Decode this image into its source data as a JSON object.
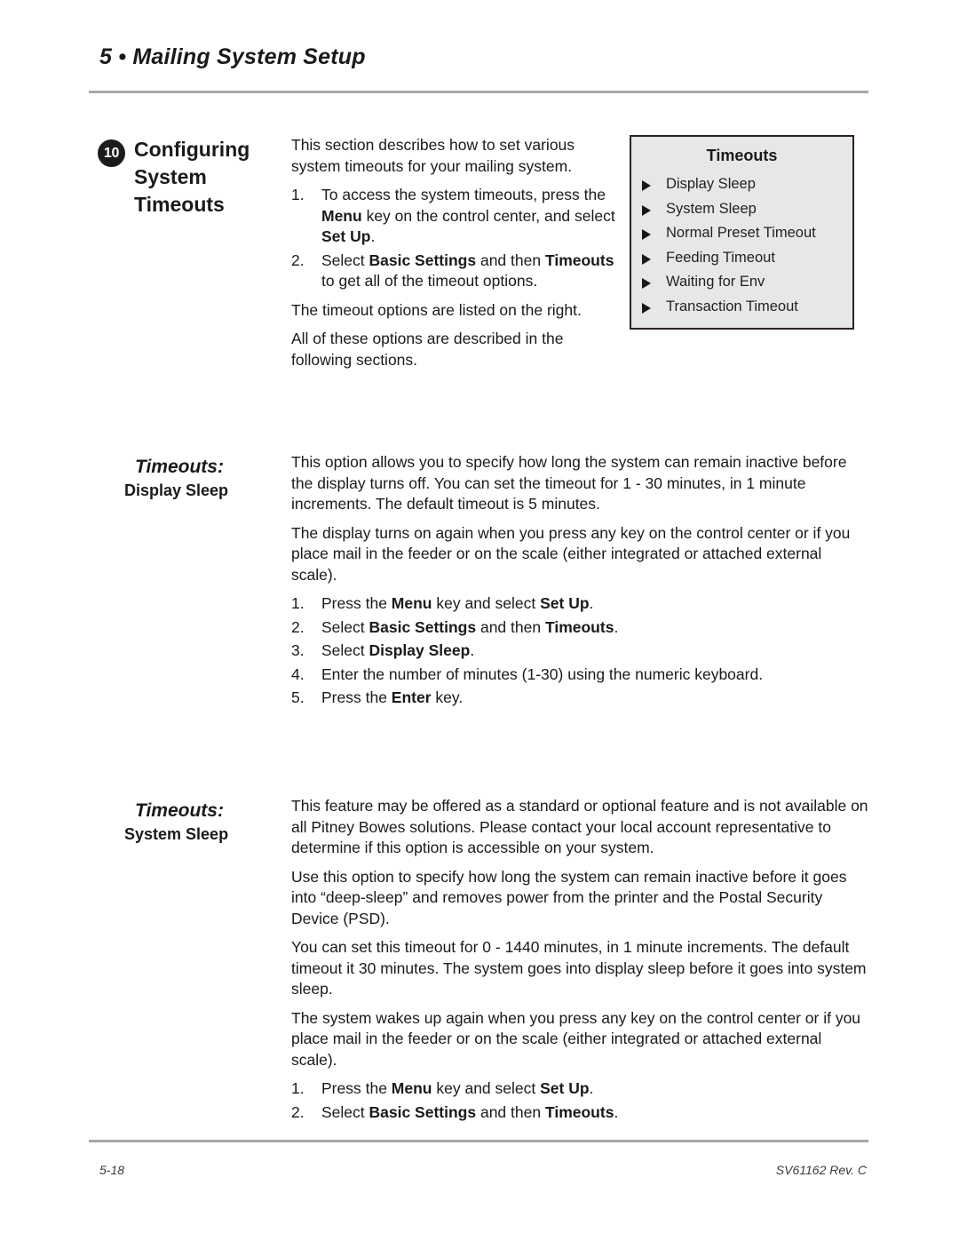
{
  "header": {
    "chapter": "5 • Mailing System Setup"
  },
  "footer": {
    "page_number": "5-18",
    "doc_ref": "SV61162 Rev. C"
  },
  "section": {
    "badge": "10",
    "title": "Configuring System Timeouts"
  },
  "intro": {
    "paragraph_1": "This section describes how to set various system timeouts for your mailing system.",
    "steps": [
      {
        "num": "1.",
        "segments": [
          {
            "text": "To access the system timeouts, press the ",
            "bold": false
          },
          {
            "text": "Menu",
            "bold": true
          },
          {
            "text": " key on the control center, and select ",
            "bold": false
          },
          {
            "text": "Set Up",
            "bold": true
          },
          {
            "text": ".",
            "bold": false
          }
        ]
      },
      {
        "num": "2.",
        "segments": [
          {
            "text": "Select ",
            "bold": false
          },
          {
            "text": "Basic Settings",
            "bold": true
          },
          {
            "text": " and then ",
            "bold": false
          },
          {
            "text": "Timeouts",
            "bold": true
          },
          {
            "text": " to get all of the timeout options.",
            "bold": false
          }
        ]
      }
    ],
    "paragraph_2": "The timeout options are listed on the right.",
    "paragraph_3": "All of these options are described in the following sections."
  },
  "callout": {
    "title": "Timeouts",
    "bullet_icon": "triangle-right-icon",
    "items": [
      "Display Sleep",
      "System Sleep",
      "Normal Preset Timeout",
      "Feeding Timeout",
      "Waiting for Env",
      "Transaction Timeout"
    ]
  },
  "display_sleep": {
    "sidehead_label": "Timeouts:",
    "sidehead_sub": "Display Sleep",
    "paragraph_1": "This option allows you to specify how long the system can remain inactive before the display turns off. You can set the timeout for 1 - 30 minutes, in 1 minute increments. The default timeout is 5 minutes.",
    "paragraph_2": "The display turns on again when you press any key on the control center or if you place mail in the feeder or on the scale (either integrated or attached external scale).",
    "steps": [
      {
        "num": "1.",
        "segments": [
          {
            "text": "Press the ",
            "bold": false
          },
          {
            "text": "Menu",
            "bold": true
          },
          {
            "text": " key and select ",
            "bold": false
          },
          {
            "text": "Set Up",
            "bold": true
          },
          {
            "text": ".",
            "bold": false
          }
        ]
      },
      {
        "num": "2.",
        "segments": [
          {
            "text": "Select ",
            "bold": false
          },
          {
            "text": "Basic Settings",
            "bold": true
          },
          {
            "text": " and then ",
            "bold": false
          },
          {
            "text": "Timeouts",
            "bold": true
          },
          {
            "text": ".",
            "bold": false
          }
        ]
      },
      {
        "num": "3.",
        "segments": [
          {
            "text": "Select ",
            "bold": false
          },
          {
            "text": "Display Sleep",
            "bold": true
          },
          {
            "text": ".",
            "bold": false
          }
        ]
      },
      {
        "num": "4.",
        "segments": [
          {
            "text": "Enter the number of minutes (1-30) using the numeric keyboard.",
            "bold": false
          }
        ]
      },
      {
        "num": "5.",
        "segments": [
          {
            "text": "Press the ",
            "bold": false
          },
          {
            "text": "Enter",
            "bold": true
          },
          {
            "text": " key.",
            "bold": false
          }
        ]
      }
    ]
  },
  "system_sleep": {
    "sidehead_label": "Timeouts:",
    "sidehead_sub": "System Sleep",
    "paragraph_1": "This feature may be offered as a standard or optional feature and is not available on all Pitney Bowes solutions. Please contact your local account representative to determine if this option is accessible on your system.",
    "paragraph_2": "Use this option to specify how long the system can remain inactive before it goes into “deep-sleep” and removes power from the printer and the Postal Security Device (PSD).",
    "paragraph_3": "You can set this timeout for 0 - 1440 minutes, in 1 minute increments.  The default timeout it 30 minutes. The system goes into display sleep before it goes into system sleep.",
    "paragraph_4": "The system wakes up again when you press any key on the control center or if you place mail in the feeder or on the scale (either integrated or attached external scale).",
    "steps": [
      {
        "num": "1.",
        "segments": [
          {
            "text": "Press the ",
            "bold": false
          },
          {
            "text": "Menu",
            "bold": true
          },
          {
            "text": " key and select ",
            "bold": false
          },
          {
            "text": "Set Up",
            "bold": true
          },
          {
            "text": ".",
            "bold": false
          }
        ]
      },
      {
        "num": "2.",
        "segments": [
          {
            "text": "Select ",
            "bold": false
          },
          {
            "text": "Basic Settings",
            "bold": true
          },
          {
            "text": " and then ",
            "bold": false
          },
          {
            "text": "Timeouts",
            "bold": true
          },
          {
            "text": ".",
            "bold": false
          }
        ]
      }
    ]
  },
  "colors": {
    "text": "#1a1a1a",
    "rule": "#a7a7a7",
    "callout_bg": "#e7e7e7",
    "callout_border": "#2b2220",
    "badge_bg": "#1c1c1c"
  }
}
